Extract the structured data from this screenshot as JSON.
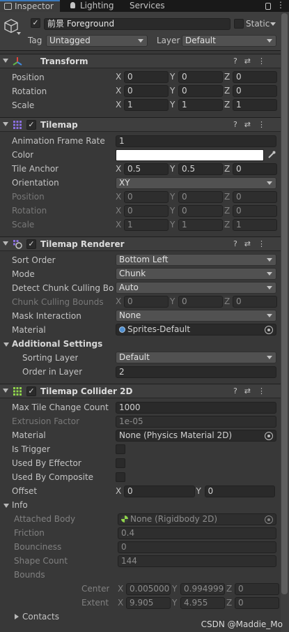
{
  "tabs": {
    "inspector": "Inspector",
    "lighting": "Lighting",
    "services": "Services"
  },
  "gameobject": {
    "name": "前景 Foreground",
    "static_label": "Static",
    "tag_label": "Tag",
    "tag_value": "Untagged",
    "layer_label": "Layer",
    "layer_value": "Default"
  },
  "transform": {
    "title": "Transform",
    "position_label": "Position",
    "rotation_label": "Rotation",
    "scale_label": "Scale",
    "position": {
      "x": "0",
      "y": "0",
      "z": "0"
    },
    "rotation": {
      "x": "0",
      "y": "0",
      "z": "0"
    },
    "scale": {
      "x": "1",
      "y": "1",
      "z": "1"
    }
  },
  "tilemap": {
    "title": "Tilemap",
    "anim_rate_label": "Animation Frame Rate",
    "anim_rate": "1",
    "color_label": "Color",
    "color_value": "#ffffff",
    "anchor_label": "Tile Anchor",
    "anchor": {
      "x": "0.5",
      "y": "0.5",
      "z": "0"
    },
    "orientation_label": "Orientation",
    "orientation": "XY",
    "position_label": "Position",
    "position": {
      "x": "0",
      "y": "0",
      "z": "0"
    },
    "rotation_label": "Rotation",
    "rotation": {
      "x": "0",
      "y": "0",
      "z": "0"
    },
    "scale_label": "Scale",
    "scale": {
      "x": "1",
      "y": "1",
      "z": "1"
    }
  },
  "renderer": {
    "title": "Tilemap Renderer",
    "sort_order_label": "Sort Order",
    "sort_order": "Bottom Left",
    "mode_label": "Mode",
    "mode": "Chunk",
    "culling_label": "Detect Chunk Culling Bou",
    "culling": "Auto",
    "bounds_label": "Chunk Culling Bounds",
    "bounds": {
      "x": "0",
      "y": "0",
      "z": "0"
    },
    "mask_label": "Mask Interaction",
    "mask": "None",
    "material_label": "Material",
    "material": "Sprites-Default",
    "additional_label": "Additional Settings",
    "sorting_layer_label": "Sorting Layer",
    "sorting_layer": "Default",
    "order_label": "Order in Layer",
    "order": "2"
  },
  "collider": {
    "title": "Tilemap Collider 2D",
    "max_tile_label": "Max Tile Change Count",
    "max_tile": "1000",
    "extrusion_label": "Extrusion Factor",
    "extrusion": "1e-05",
    "material_label": "Material",
    "material": "None (Physics Material 2D)",
    "trigger_label": "Is Trigger",
    "effector_label": "Used By Effector",
    "composite_label": "Used By Composite",
    "offset_label": "Offset",
    "offset": {
      "x": "0",
      "y": "0"
    },
    "info_label": "Info",
    "attached_label": "Attached Body",
    "attached": "None (Rigidbody 2D)",
    "friction_label": "Friction",
    "friction": "0.4",
    "bounciness_label": "Bounciness",
    "bounciness": "0",
    "shape_count_label": "Shape Count",
    "shape_count": "144",
    "bounds_label": "Bounds",
    "center_label": "Center",
    "center": {
      "x": "0.005000",
      "y": "0.994999",
      "z": "0"
    },
    "extent_label": "Extent",
    "extent": {
      "x": "9.905",
      "y": "4.955",
      "z": "0"
    },
    "contacts_label": "Contacts"
  },
  "axes": {
    "x": "X",
    "y": "Y",
    "z": "Z"
  },
  "watermark": "CSDN @Maddie_Mo",
  "colors": {
    "accent": "#3a79bb",
    "transform_icon_red": "#e0463d",
    "transform_icon_green": "#62b34a",
    "transform_icon_blue": "#3f8ae0",
    "tilemap_icon": "#8a6fe0",
    "collider_icon": "#8fd44b"
  },
  "icons": [
    "cube-icon",
    "lock-icon",
    "menu-icon",
    "help-icon",
    "preset-icon",
    "kebab-icon",
    "eyedropper-icon",
    "object-picker-icon",
    "rigidbody-icon",
    "sprite-material-icon",
    "transform-icon",
    "tilemap-icon",
    "tilemap-renderer-icon",
    "tilemap-collider-icon"
  ]
}
